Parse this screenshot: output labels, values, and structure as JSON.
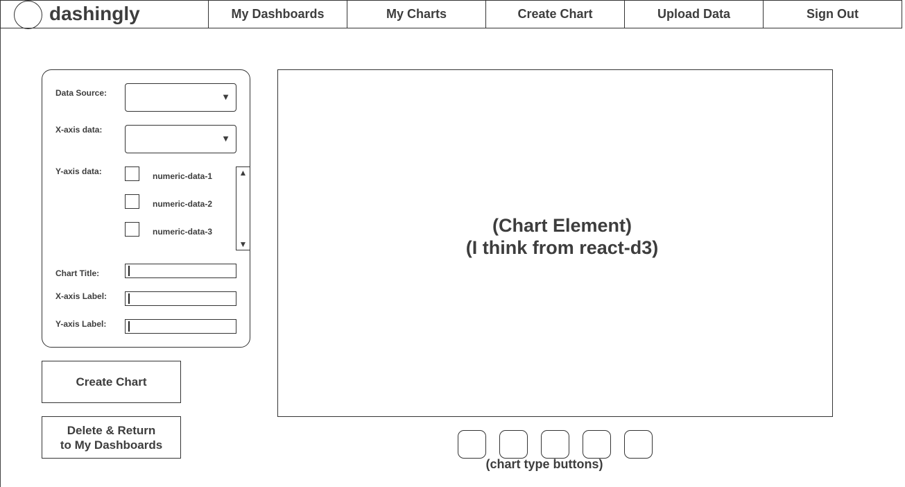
{
  "app": {
    "name": "dashingly"
  },
  "nav": {
    "my_dashboards": "My Dashboards",
    "my_charts": "My Charts",
    "create_chart": "Create Chart",
    "upload_data": "Upload Data",
    "sign_out": "Sign Out"
  },
  "form": {
    "data_source": {
      "label": "Data Source:",
      "value": ""
    },
    "x_axis_data": {
      "label": "X-axis data:",
      "value": ""
    },
    "y_axis_data": {
      "label": "Y-axis data:",
      "options": [
        {
          "label": "numeric-data-1",
          "checked": false
        },
        {
          "label": "numeric-data-2",
          "checked": false
        },
        {
          "label": "numeric-data-3",
          "checked": false
        }
      ]
    },
    "chart_title": {
      "label": "Chart Title:",
      "value": ""
    },
    "x_axis_label": {
      "label": "X-axis Label:",
      "value": ""
    },
    "y_axis_label": {
      "label": "Y-axis Label:",
      "value": ""
    },
    "icons": {
      "dropdown": "▼",
      "scroll_up": "▲",
      "scroll_down": "▼"
    }
  },
  "buttons": {
    "create_chart": "Create Chart",
    "delete_return_line1": "Delete & Return",
    "delete_return_line2": "to My Dashboards"
  },
  "chart": {
    "placeholder_line1": "(Chart Element)",
    "placeholder_line2": "(I think from react-d3)",
    "type_buttons_caption": "(chart type buttons)"
  },
  "colors": {
    "border": "#333333",
    "text": "#3d3d3d",
    "background": "#ffffff"
  }
}
